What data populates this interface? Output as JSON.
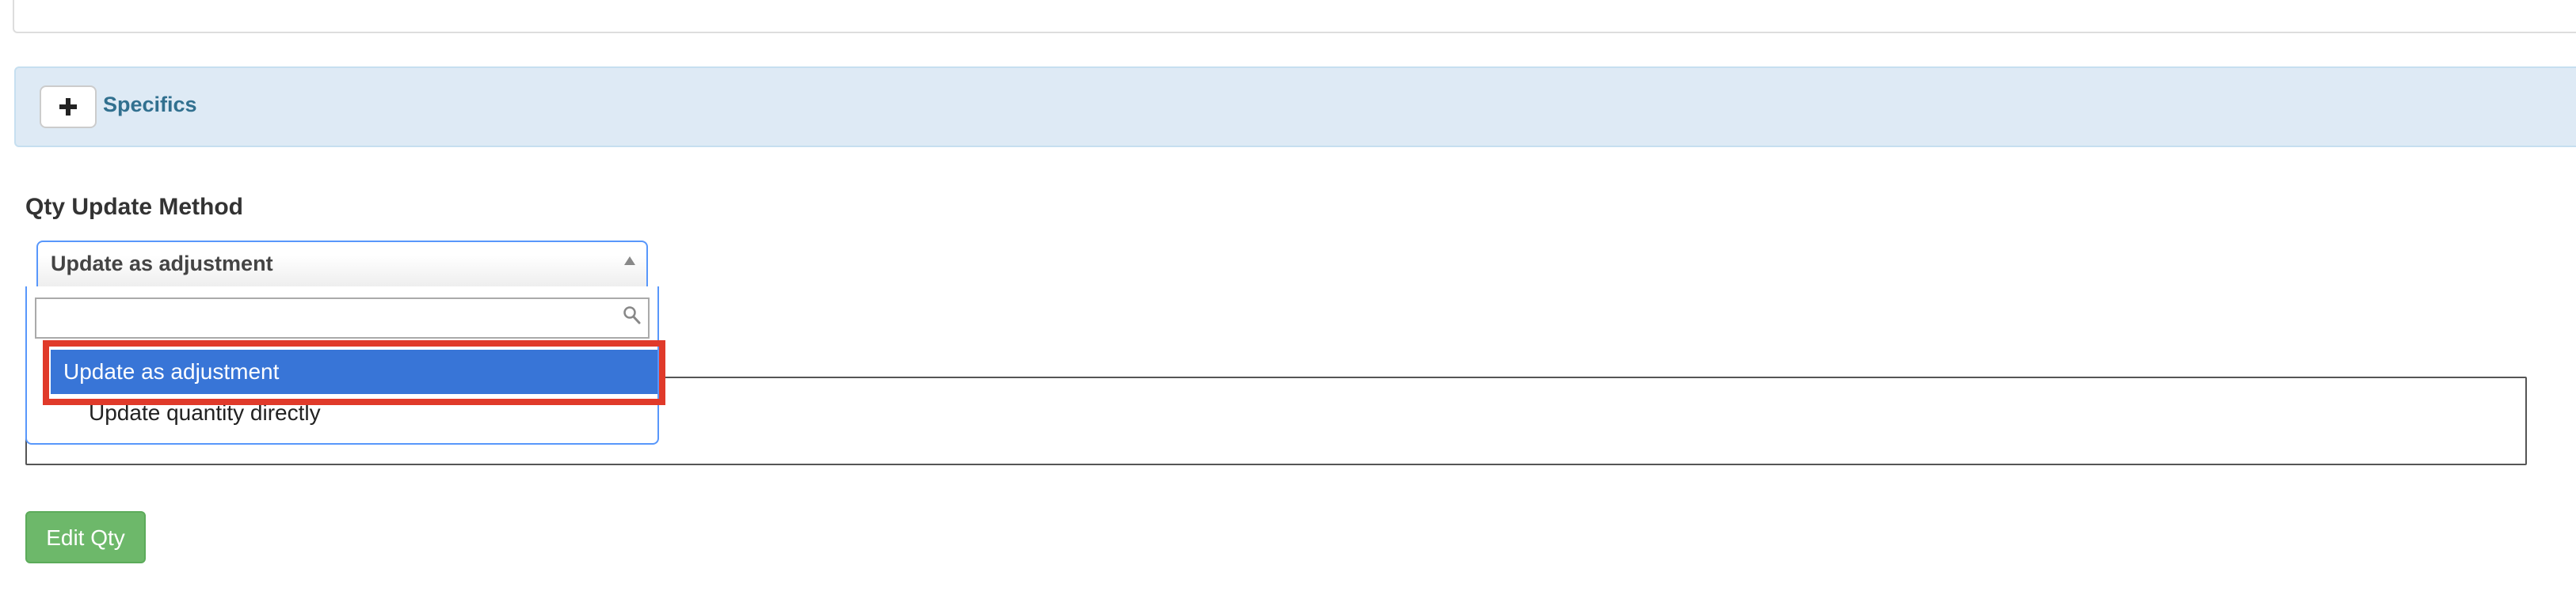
{
  "specifics": {
    "label": "Specifics",
    "toggle_icon": "plus-icon"
  },
  "qty_update": {
    "label": "Qty Update Method",
    "selected_value": "Update as adjustment",
    "search_placeholder": "",
    "options": [
      {
        "label": "Update as adjustment",
        "highlighted": true
      },
      {
        "label": "Update quantity directly",
        "highlighted": false
      }
    ]
  },
  "notes": {
    "value": ""
  },
  "actions": {
    "edit_qty_label": "Edit Qty"
  },
  "colors": {
    "panel_info_bg": "#deeaf5",
    "panel_info_text": "#31708f",
    "select_focus_border": "#5897fb",
    "option_highlight_bg": "#3875d7",
    "annotation_outline": "#e03a2a",
    "success_button": "#6db86a"
  }
}
